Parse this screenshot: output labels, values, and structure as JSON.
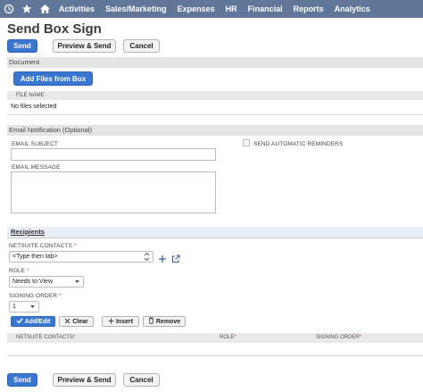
{
  "nav": {
    "items": [
      "Activities",
      "Sales/Marketing",
      "Expenses",
      "HR",
      "Financial",
      "Reports",
      "Analytics"
    ]
  },
  "title": "Send Box Sign",
  "buttons": {
    "send": "Send",
    "preview_send": "Preview & Send",
    "cancel": "Cancel"
  },
  "document": {
    "section": "Document",
    "add_files": "Add Files from Box",
    "column": "FILE NAME",
    "empty": "No files selected"
  },
  "email": {
    "section": "Email Notification (Optional)",
    "subject_label": "EMAIL SUBJECT",
    "subject_value": "",
    "message_label": "EMAIL MESSAGE",
    "message_value": "",
    "reminders_label": "SEND AUTOMATIC REMINDERS",
    "reminders_checked": false
  },
  "recipients": {
    "tab": "Recipients",
    "contacts_label": "NETSUITE CONTACTS",
    "contacts_placeholder": "<Type then tab>",
    "role_label": "ROLE",
    "role_value": "Needs to View",
    "order_label": "SIGNING ORDER",
    "order_value": "1",
    "add_edit": "Add/Edit",
    "clear": "Clear",
    "insert": "Insert",
    "remove": "Remove",
    "columns": [
      "NETSUITE CONTACTS",
      "ROLE",
      "SIGNING ORDER"
    ],
    "required_mark": "*"
  }
}
